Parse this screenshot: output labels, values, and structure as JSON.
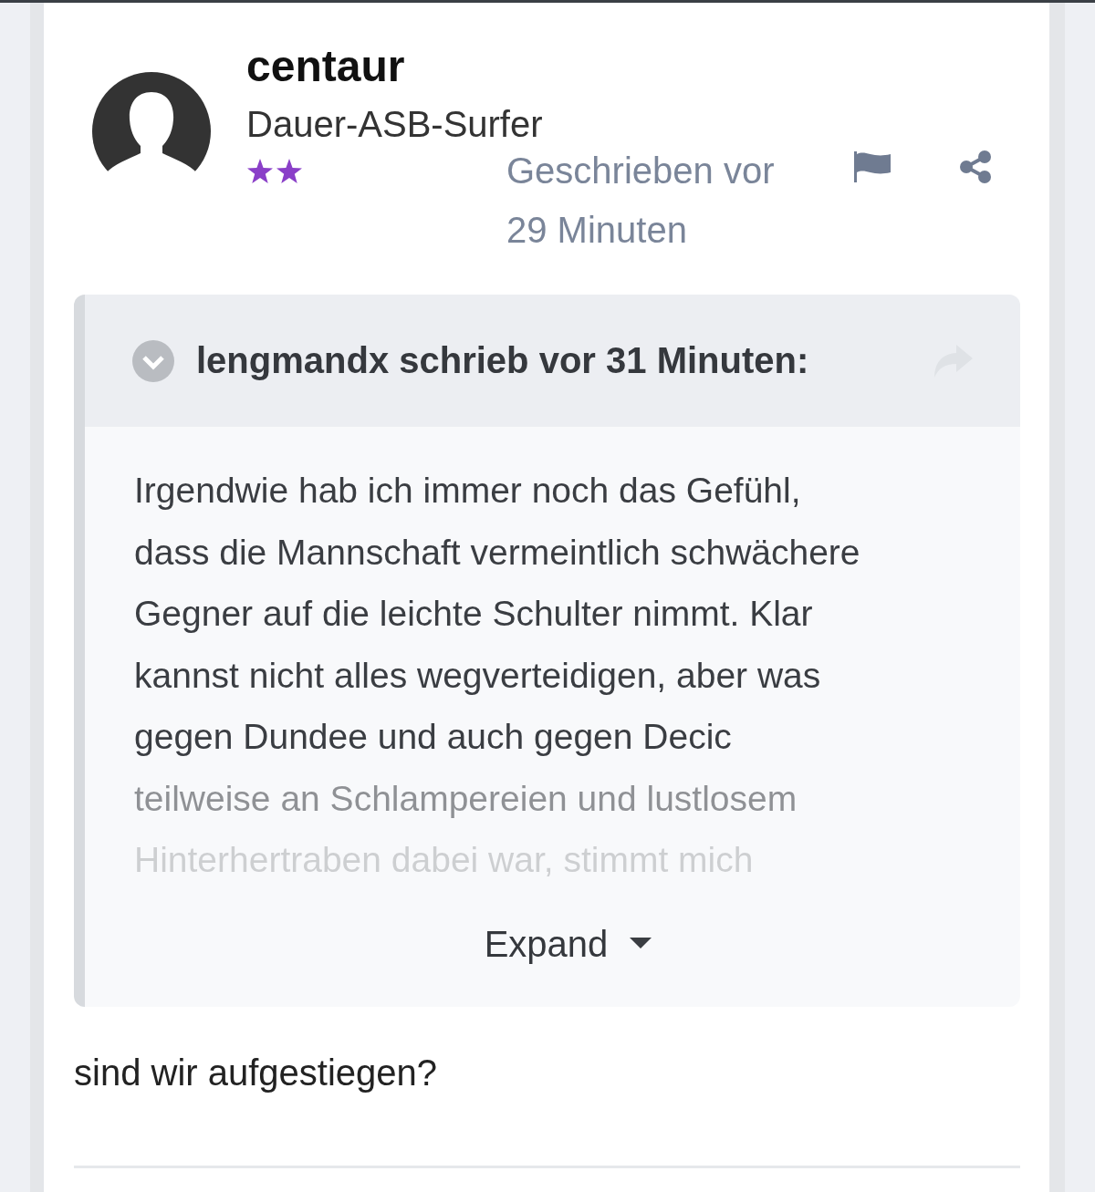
{
  "post": {
    "author": "centaur",
    "rank_title": "Dauer-ASB-Surfer",
    "time": [
      "Geschrieben vor",
      "29 Minuten"
    ],
    "quote": {
      "header": "lengmandx schrieb vor 31 Minuten:",
      "collapsed": true,
      "lines": [
        "Irgendwie hab ich immer noch das Gefühl,",
        "dass die Mannschaft vermeintlich schwächere",
        "Gegner auf die leichte Schulter nimmt. Klar",
        "kannst nicht alles wegverteidigen, aber was",
        "gegen Dundee und auch gegen Decic",
        "teilweise an Schlampereien und lustlosem",
        "Hinterhertraben dabei war, stimmt mich"
      ],
      "expand_label": "Expand"
    },
    "body": "sind wir aufgestiegen?"
  }
}
